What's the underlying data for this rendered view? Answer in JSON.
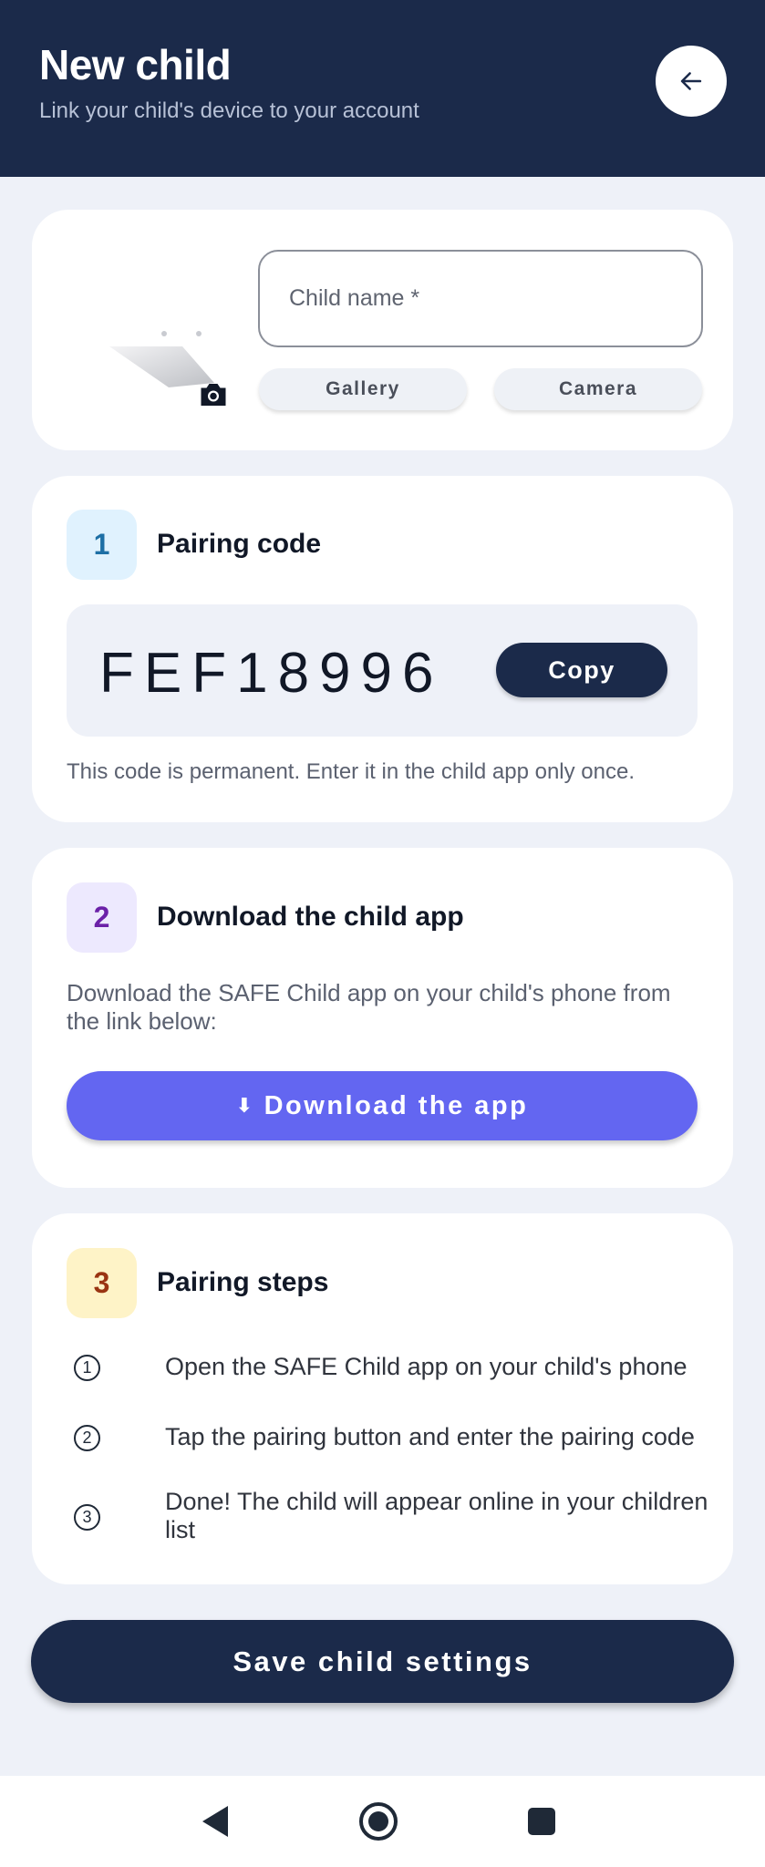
{
  "header": {
    "title": "New child",
    "subtitle": "Link your child's device to your account",
    "back_icon": "arrow-left-icon"
  },
  "profile": {
    "name_placeholder": "Child name *",
    "gallery_label": "Gallery",
    "camera_label": "Camera",
    "camera_icon": "camera-icon"
  },
  "pairing": {
    "step": "1",
    "title": "Pairing code",
    "code": "FEF18996",
    "copy_label": "Copy",
    "note": "This code is permanent. Enter it in the child app only once."
  },
  "download": {
    "step": "2",
    "title": "Download the child app",
    "description": "Download the SAFE Child app on your child's phone from the link below:",
    "button_icon": "⬇",
    "button_label": "Download the app"
  },
  "steps": {
    "step": "3",
    "title": "Pairing steps",
    "items": [
      {
        "num": "1",
        "text": "Open the SAFE Child app on your child's phone"
      },
      {
        "num": "2",
        "text": "Tap the pairing button and enter the pairing code"
      },
      {
        "num": "3",
        "text": "Done! The child will appear online in your children list"
      }
    ]
  },
  "save_label": "Save child settings",
  "colors": {
    "header_bg": "#1b2a4a",
    "accent": "#6366f1",
    "step1_bg": "#e0f2fe",
    "step2_bg": "#ede9fe",
    "step3_bg": "#fef3c7"
  }
}
